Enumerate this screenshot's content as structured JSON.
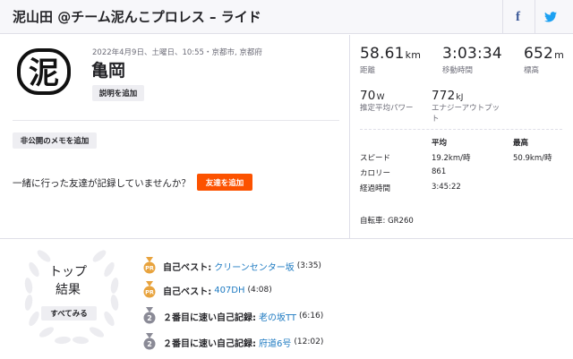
{
  "header": {
    "title": "泥山田 @チーム泥んこプロレス – ライド",
    "facebook_icon": "facebook-icon",
    "twitter_icon": "twitter-icon",
    "facebook_glyph": "f"
  },
  "activity": {
    "logo_char": "泥",
    "meta": "2022年4月9日、土曜日、10:55・京都市, 京都府",
    "name": "亀岡",
    "add_description": "説明を追加",
    "add_private_note": "非公開のメモを追加",
    "friends_prompt": "一緒に行った友達が記録していませんか？",
    "add_friend": "友達を追加"
  },
  "stats": {
    "distance": {
      "value": "58.61",
      "unit": "km",
      "label": "距離"
    },
    "moving_time": {
      "value": "3:03:34",
      "label": "移動時間"
    },
    "elevation": {
      "value": "652",
      "unit": "m",
      "label": "標高"
    },
    "power": {
      "value": "70",
      "unit": "W",
      "label": "推定平均パワー"
    },
    "energy": {
      "value": "772",
      "unit": "kJ",
      "label_line1": "エナジーアウトプッ",
      "label_line2": "ト"
    }
  },
  "table": {
    "headers": [
      "",
      "平均",
      "最高"
    ],
    "rows": [
      {
        "label": "スピード",
        "avg": "19.2km/時",
        "max": "50.9km/時"
      },
      {
        "label": "カロリー",
        "avg": "861",
        "max": ""
      },
      {
        "label": "経過時間",
        "avg": "3:45:22",
        "max": ""
      }
    ]
  },
  "bike": "自転車: GR260",
  "top_results": {
    "title_line1": "トップ",
    "title_line2": "結果",
    "see_all": "すべてみる",
    "achievements": [
      {
        "medal": "pr",
        "badge": "PR",
        "label": "自己ベスト:",
        "segment": "クリーンセンター坂",
        "time": "(3:35)"
      },
      {
        "medal": "pr",
        "badge": "PR",
        "label": "自己ベスト:",
        "segment": "407DH",
        "time": "(4:08)"
      },
      {
        "medal": "silver",
        "badge": "2",
        "label": "２番目に速い自己記録:",
        "segment": "老の坂TT",
        "time": "(6:16)"
      },
      {
        "medal": "silver",
        "badge": "2",
        "label": "２番目に速い自己記録:",
        "segment": "府道6号",
        "time": "(12:02)"
      }
    ]
  },
  "colors": {
    "accent": "#fc5200",
    "link": "#1f7bc2",
    "pr_gold": "#e8a33d",
    "silver": "#8a8a96",
    "facebook": "#3b5998",
    "twitter": "#1da1f2"
  }
}
